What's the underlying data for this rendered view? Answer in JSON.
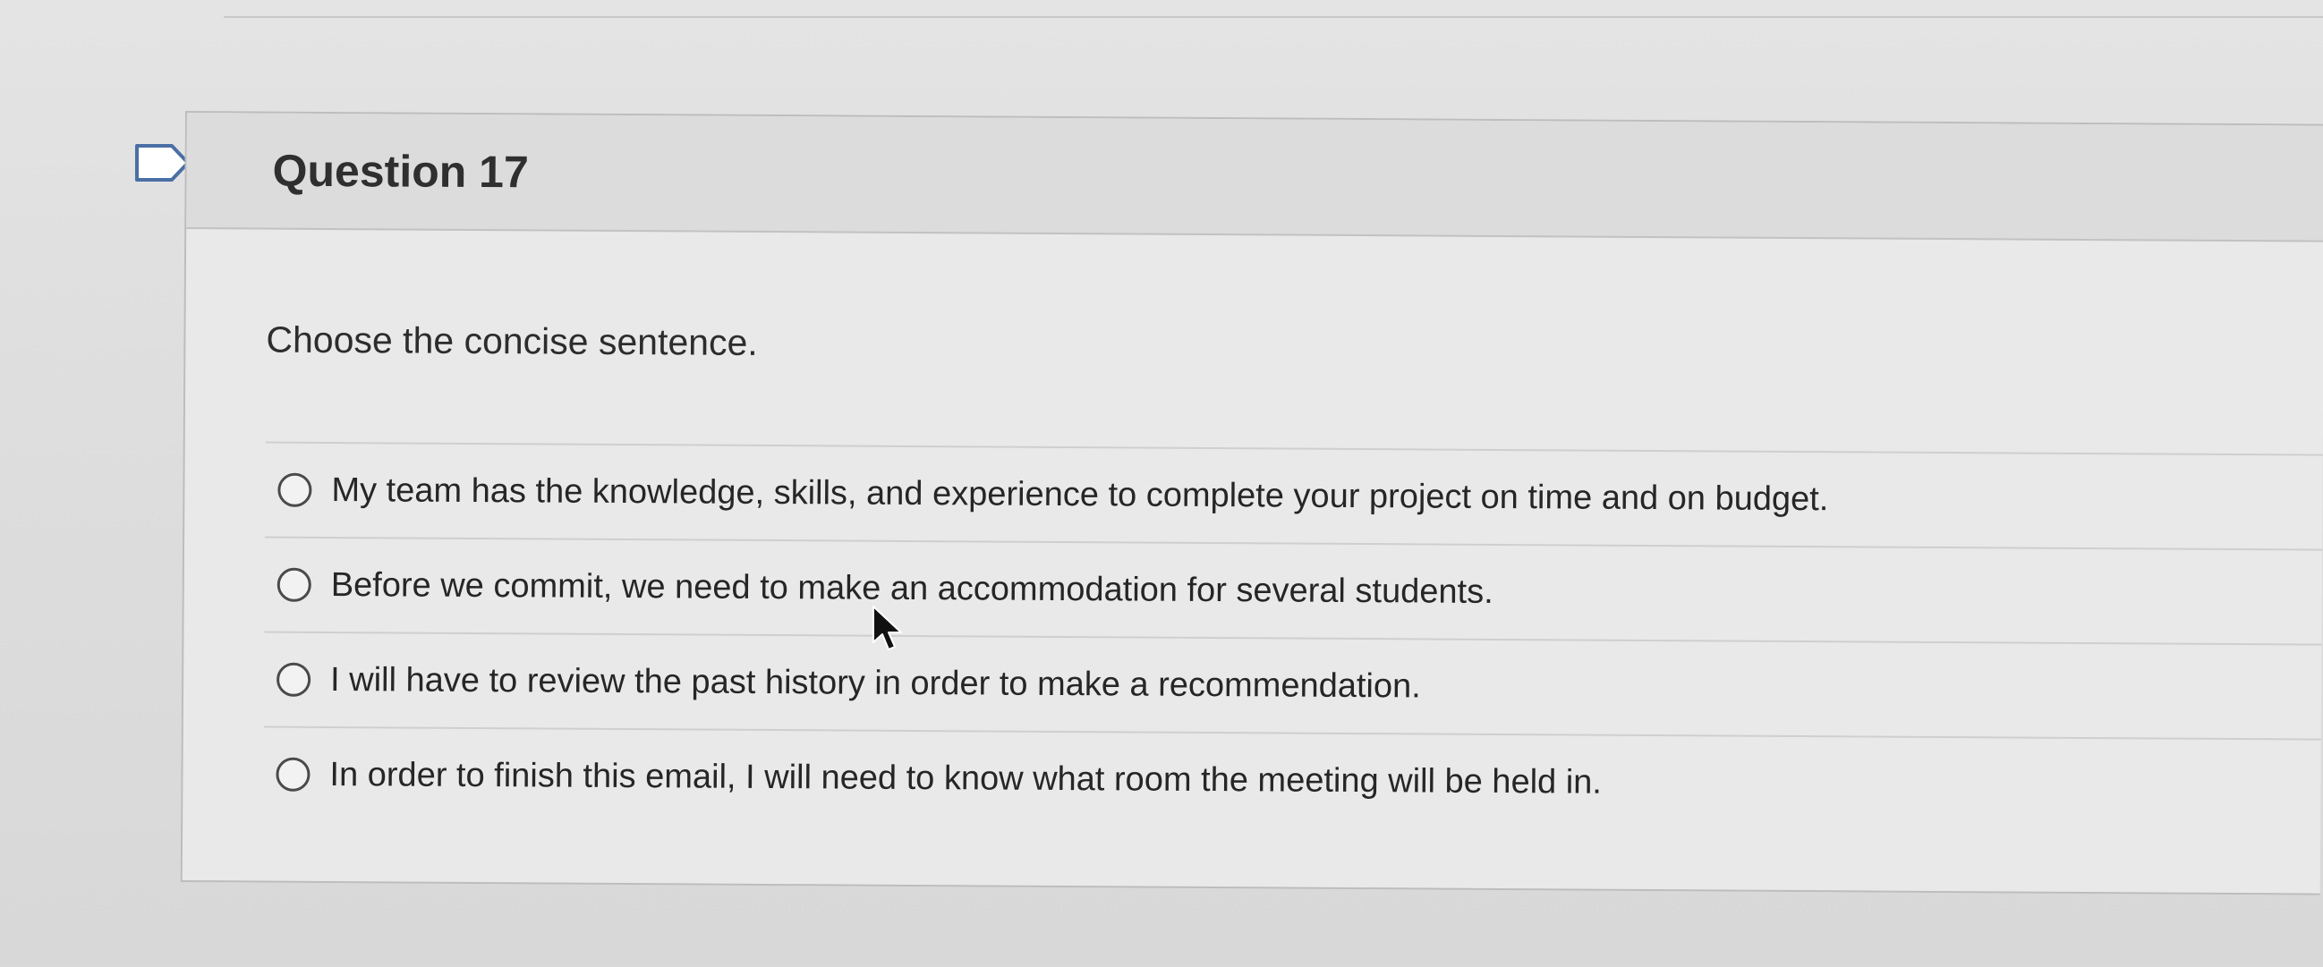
{
  "question": {
    "title": "Question 17",
    "prompt": "Choose the concise sentence."
  },
  "answers": [
    {
      "label": "My team has the knowledge, skills, and experience to complete your project on time and on budget."
    },
    {
      "label": "Before we commit, we need to make an accommodation for several students."
    },
    {
      "label": "I will have to review the past history in order to make a recommendation."
    },
    {
      "label": "In order to finish this email, I will need to know what room the meeting will be held in."
    }
  ],
  "icons": {
    "flag": "flag-icon",
    "radio": "radio-icon",
    "cursor": "mouse-pointer-icon"
  },
  "colors": {
    "background": "#dedede",
    "header": "#dcdcdc",
    "text": "#2b2b2b"
  }
}
